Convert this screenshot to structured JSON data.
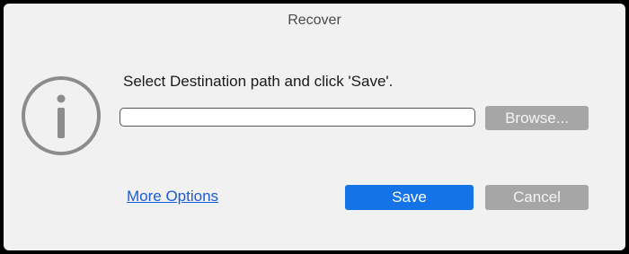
{
  "dialog": {
    "title": "Recover",
    "message": "Select Destination path and click 'Save'.",
    "path_input": {
      "value": "",
      "placeholder": ""
    },
    "browse_label": "Browse...",
    "more_options_label": "More Options",
    "save_label": "Save",
    "cancel_label": "Cancel"
  },
  "icons": {
    "info": "info-icon"
  },
  "colors": {
    "primary": "#1473e6",
    "secondary_button": "#a6a6a6",
    "link": "#1a5bd6",
    "dialog_background": "#f1f1f1"
  }
}
